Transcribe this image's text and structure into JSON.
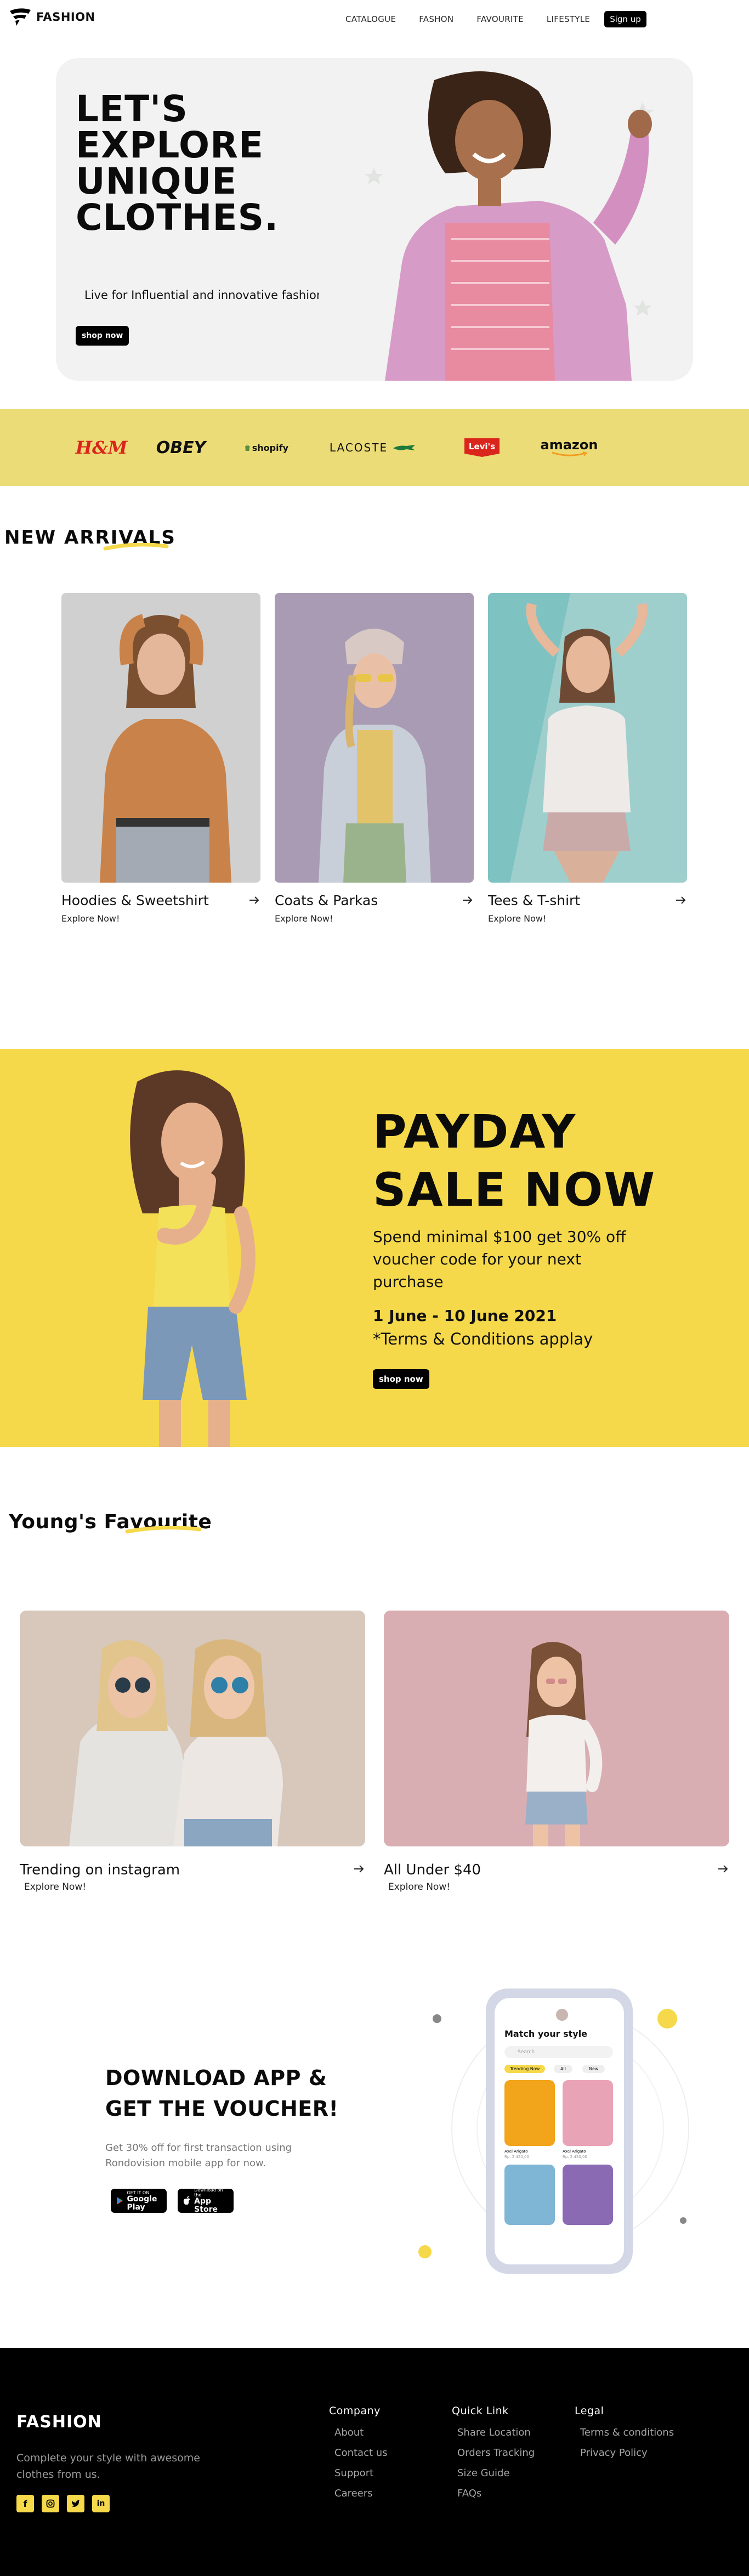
{
  "nav": {
    "brand": "FASHION",
    "links": [
      "CATALOGUE",
      "FASHON",
      "FAVOURITE",
      "LIFESTYLE"
    ],
    "signup": "Sign up"
  },
  "hero": {
    "title_lines": [
      "LET'S",
      "EXPLORE",
      "UNIQUE",
      "CLOTHES."
    ],
    "subtitle": "Live for Influential and innovative fashion!",
    "button": "shop now"
  },
  "brands": [
    "H&M",
    "OBEY",
    "shopify",
    "LACOSTE",
    "Levi's",
    "amazon"
  ],
  "new_arrivals": {
    "title": "NEW ARRIVALS",
    "cards": [
      {
        "title": "Hoodies & Sweetshirt",
        "sub": "Explore Now!"
      },
      {
        "title": "Coats & Parkas",
        "sub": "Explore Now!"
      },
      {
        "title": "Tees & T-shirt",
        "sub": "Explore Now!"
      }
    ]
  },
  "payday": {
    "title_lines": [
      "PAYDAY",
      "SALE NOW"
    ],
    "desc": "Spend minimal $100 get 30% off voucher code for your next purchase",
    "date": "1 June - 10 June 2021",
    "terms": "*Terms & Conditions applay",
    "button": "shop now"
  },
  "young": {
    "title": "Young's Favourite",
    "cards": [
      {
        "title": "Trending on instagram",
        "sub": "Explore Now!"
      },
      {
        "title": "All Under $40",
        "sub": "Explore Now!"
      }
    ]
  },
  "app": {
    "title_lines": [
      "DOWNLOAD APP &",
      "GET THE VOUCHER!"
    ],
    "desc": "Get 30% off for first transaction using Rondovision mobile app for now.",
    "google": {
      "small": "GET IT ON",
      "big": "Google Play"
    },
    "apple": {
      "small": "Download on the",
      "big": "App Store"
    },
    "phone": {
      "heading": "Match your style",
      "search": "Search",
      "chips": [
        "Trending Now",
        "All",
        "New"
      ],
      "items": [
        {
          "name": "Axel Arigato",
          "price": "Rp. 2.450,00"
        },
        {
          "name": "Axel Arigato",
          "price": "Rp. 2.450,00"
        }
      ]
    }
  },
  "footer": {
    "brand": "FASHION",
    "desc": "Complete your style with awesome clothes from us.",
    "social": [
      "f",
      "ig",
      "tw",
      "in"
    ],
    "columns": [
      {
        "title": "Company",
        "links": [
          "About",
          "Contact us",
          "Support",
          "Careers"
        ]
      },
      {
        "title": "Quick Link",
        "links": [
          "Share Location",
          "Orders Tracking",
          "Size Guide",
          "FAQs"
        ]
      },
      {
        "title": "Legal",
        "links": [
          "Terms & conditions",
          "Privacy Policy"
        ]
      }
    ]
  },
  "colors": {
    "accent_yellow": "#f5d94a",
    "brand_bar": "#ecdc77",
    "black": "#000000"
  }
}
